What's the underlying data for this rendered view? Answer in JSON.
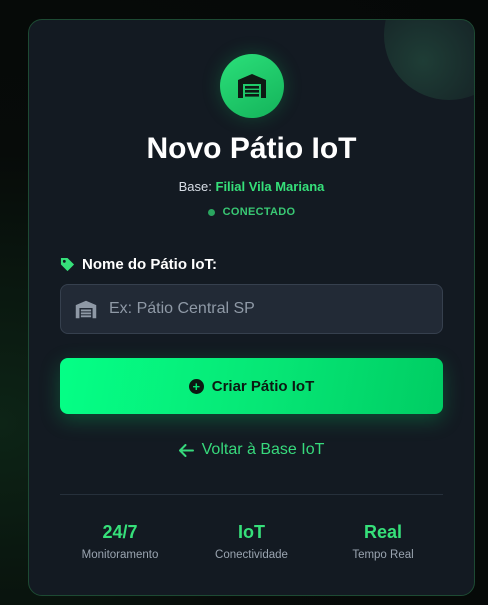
{
  "header": {
    "title": "Novo Pátio IoT",
    "base_prefix": "Base:",
    "base_name": "Filial Vila Mariana",
    "status": "CONECTADO"
  },
  "form": {
    "label": "Nome do Pátio IoT:",
    "placeholder": "Ex: Pátio Central SP",
    "value": "",
    "submit_label": "Criar Pátio IoT"
  },
  "back_link": {
    "label": "Voltar à Base IoT"
  },
  "stats": [
    {
      "value": "24/7",
      "label": "Monitoramento"
    },
    {
      "value": "IoT",
      "label": "Conectividade"
    },
    {
      "value": "Real",
      "label": "Tempo Real"
    }
  ],
  "colors": {
    "accent": "#06e675",
    "card_bg": "#131a22",
    "input_bg": "#222a36",
    "status_green": "#39c874"
  },
  "icons": {
    "logo": "warehouse-icon",
    "label": "tag-icon",
    "input": "warehouse-icon",
    "submit": "plus-circle-icon",
    "back": "arrow-left-icon"
  }
}
